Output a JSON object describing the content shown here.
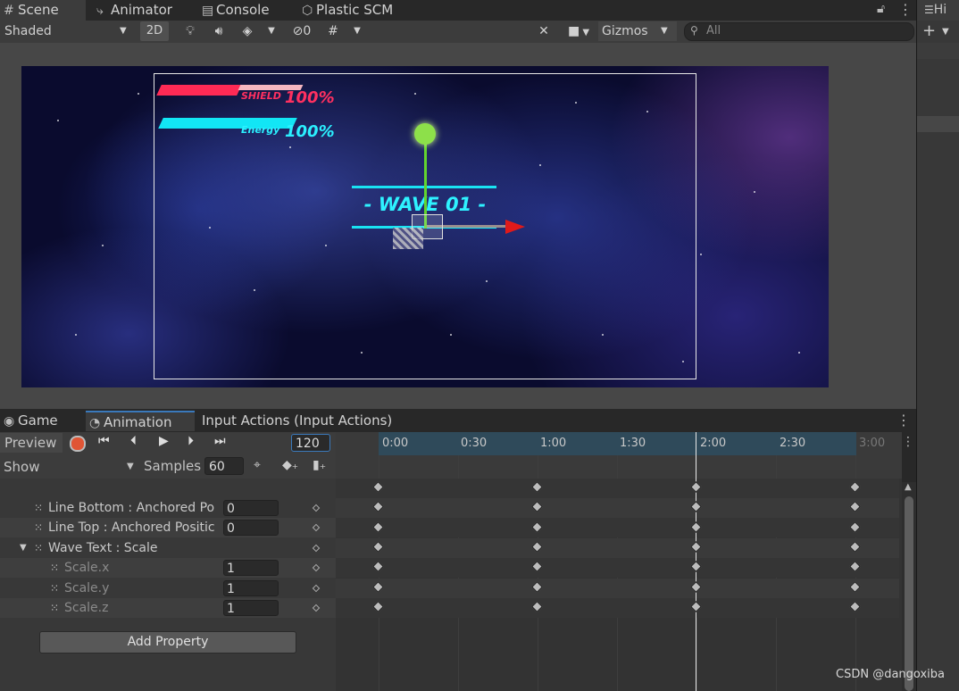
{
  "tabs": {
    "scene": "Scene",
    "animator": "Animator",
    "console": "Console",
    "plastic": "Plastic SCM"
  },
  "scene_toolbar": {
    "shading_mode": "Shaded",
    "mode_2d": "2D",
    "hidden_count": "0",
    "gizmos": "Gizmos",
    "search_placeholder": "All"
  },
  "right_panel": {
    "title": "Hi"
  },
  "game_view": {
    "shield_label": "SHIELD",
    "shield_value": "100%",
    "energy_label": "Energy",
    "energy_value": "100%",
    "wave_text": "- WAVE 01 -"
  },
  "bottom_tabs": {
    "game": "Game",
    "animation": "Animation",
    "input_actions": "Input Actions (Input Actions)"
  },
  "animation": {
    "preview": "Preview",
    "frame": "120",
    "show": "Show",
    "samples_label": "Samples",
    "samples_value": "60",
    "add_property": "Add Property",
    "timeline_ticks": [
      "0:00",
      "0:30",
      "1:00",
      "1:30",
      "2:00",
      "2:30",
      "3:00"
    ],
    "properties": [
      {
        "name": "Line Bottom : Anchored Po",
        "value": "0"
      },
      {
        "name": "Line Top : Anchored Positic",
        "value": "0"
      },
      {
        "name": "Wave Text : Scale",
        "value": ""
      },
      {
        "name": "Scale.x",
        "value": "1"
      },
      {
        "name": "Scale.y",
        "value": "1"
      },
      {
        "name": "Scale.z",
        "value": "1"
      }
    ]
  },
  "watermark": "CSDN @dangoxiba"
}
